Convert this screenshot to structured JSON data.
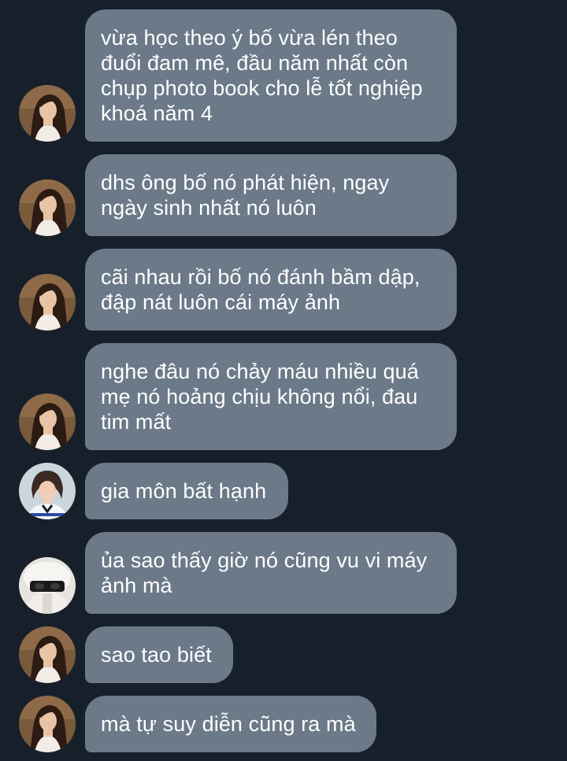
{
  "messages": [
    {
      "text": "vừa học theo ý bố vừa lén theo đuổi đam mê, đầu năm nhất còn chụp photo book cho lễ tốt nghiệp khoá năm 4",
      "avatar": "girl-avatar-icon"
    },
    {
      "text": "dhs ông bố nó phát hiện, ngay ngày sinh nhất nó luôn",
      "avatar": "girl-avatar-icon"
    },
    {
      "text": "cãi nhau rồi bố nó đánh bầm dập, đập nát luôn cái máy ảnh",
      "avatar": "girl-avatar-icon"
    },
    {
      "text": "nghe đâu nó chảy máu nhiều quá mẹ nó hoảng chịu không nổi, đau tim mất",
      "avatar": "girl-avatar-icon"
    },
    {
      "text": "gia môn bất hạnh",
      "avatar": "user-avatar-2-icon"
    },
    {
      "text": "ủa sao thấy giờ nó cũng vu vi máy ảnh mà",
      "avatar": "user-avatar-3-icon"
    },
    {
      "text": "sao tao biết",
      "avatar": "girl-avatar-icon"
    },
    {
      "text": "mà tự suy diễn cũng ra mà",
      "avatar": "girl-avatar-icon"
    }
  ],
  "colors": {
    "background": "#17202a",
    "bubble": "#6b7988",
    "text": "#ffffff"
  }
}
